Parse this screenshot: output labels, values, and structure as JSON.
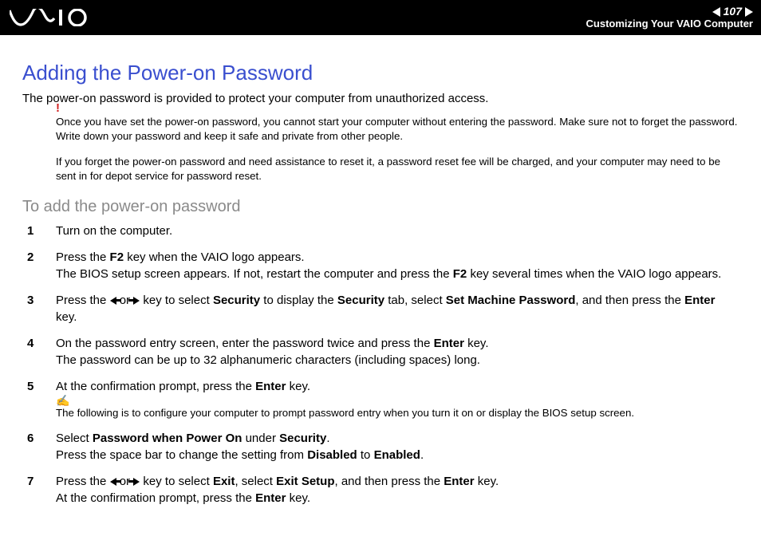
{
  "header": {
    "page_number": "107",
    "section": "Customizing Your VAIO Computer"
  },
  "title": "Adding the Power-on Password",
  "intro": "The power-on password is provided to protect your computer from unauthorized access.",
  "warning": "Once you have set the power-on password, you cannot start your computer without entering the password. Make sure not to forget the password. Write down your password and keep it safe and private from other people.",
  "warning2": "If you forget the power-on password and need assistance to reset it, a password reset fee will be charged, and your computer may need to be sent in for depot service for password reset.",
  "subtitle": "To add the power-on password",
  "tip": "The following is to configure your computer to prompt password entry when you turn it on or display the BIOS setup screen.",
  "steps": {
    "s1": "Turn on the computer.",
    "s2a": "Press the ",
    "s2b": " key when the VAIO logo appears.",
    "s2c": "The BIOS setup screen appears. If not, restart the computer and press the ",
    "s2d": " key several times when the VAIO logo appears.",
    "s3a": "Press the ",
    "s3b": " or ",
    "s3c": " key to select ",
    "s3d": " to display the ",
    "s3e": " tab, select ",
    "s3f": ", and then press the ",
    "s3g": " key.",
    "s4a": "On the password entry screen, enter the password twice and press the ",
    "s4b": " key.",
    "s4c": "The password can be up to 32 alphanumeric characters (including spaces) long.",
    "s5a": "At the confirmation prompt, press the ",
    "s5b": " key.",
    "s6a": "Select ",
    "s6b": " under ",
    "s6c": ".",
    "s6d": "Press the space bar to change the setting from ",
    "s6e": " to ",
    "s6f": ".",
    "s7a": "Press the ",
    "s7b": " or ",
    "s7c": " key to select ",
    "s7d": ", select ",
    "s7e": ", and then press the ",
    "s7f": " key.",
    "s7g": "At the confirmation prompt, press the ",
    "s7h": " key."
  },
  "bold": {
    "f2": "F2",
    "security": "Security",
    "set_machine": "Set Machine Password",
    "enter": "Enter",
    "pw_on": "Password when Power On",
    "disabled": "Disabled",
    "enabled": "Enabled",
    "exit": "Exit",
    "exit_setup": "Exit Setup"
  }
}
